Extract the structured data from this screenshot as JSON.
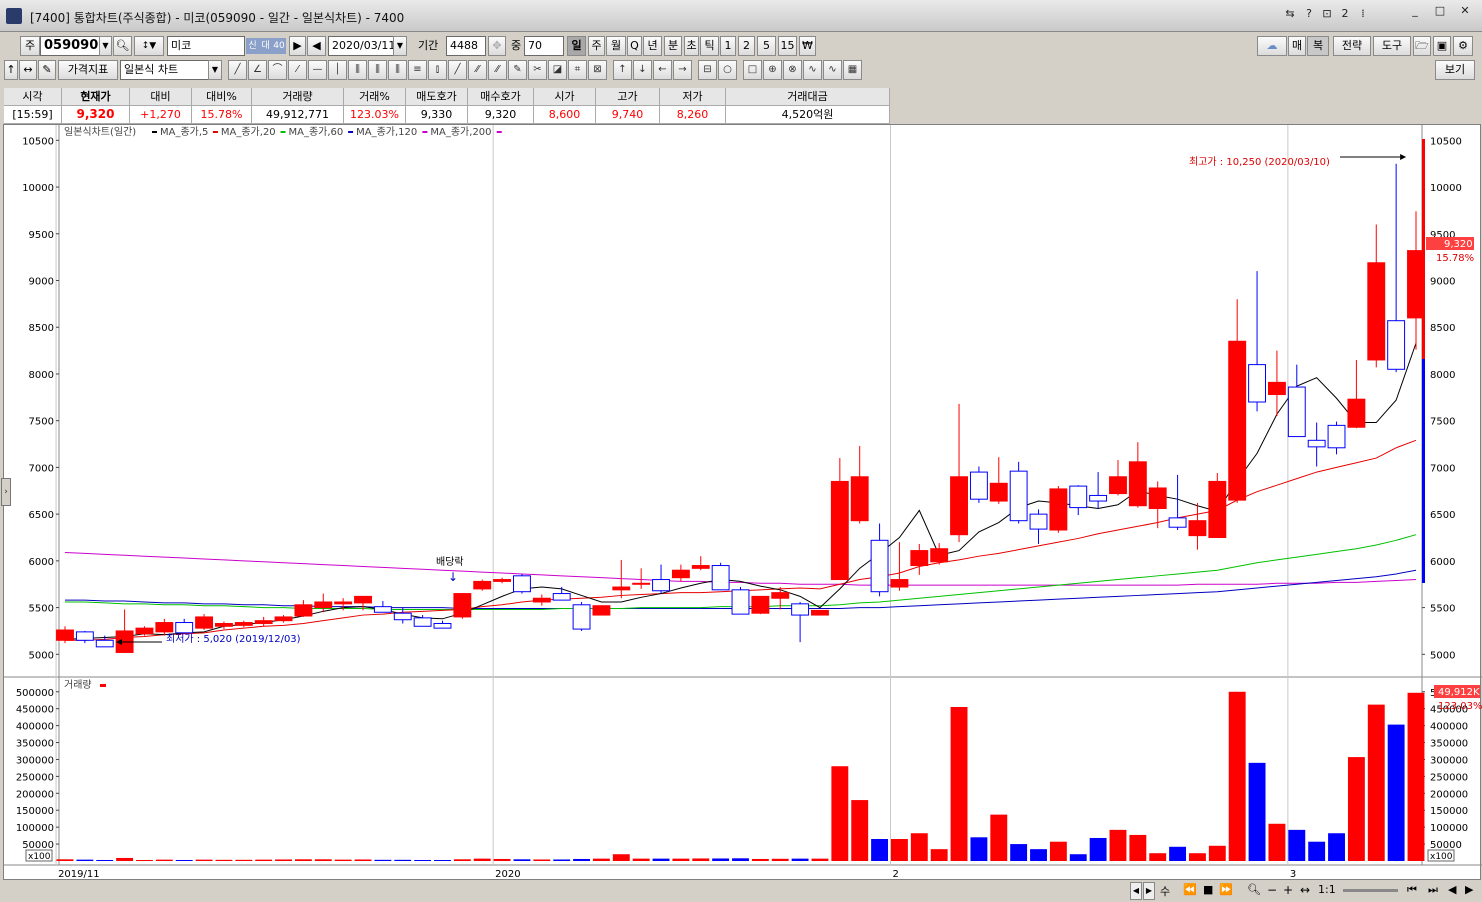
{
  "window": {
    "title": "[7400] 통합차트(주식종합) - 미코(059090 - 일간 - 일본식차트) - 7400",
    "title_icons": [
      "⇆",
      "?",
      "⊡",
      "2",
      "⁞"
    ],
    "controls": [
      "_",
      "□",
      "✕"
    ]
  },
  "toolbar1": {
    "market_label": "주",
    "code": "059090",
    "name": "미코",
    "name_badges": [
      "신",
      "대",
      "40"
    ],
    "date": "2020/03/11",
    "period_label": "기간",
    "period_value": "4488",
    "count_label": "중",
    "count_value": "70",
    "period_buttons": [
      "일",
      "주",
      "월",
      "Q",
      "년",
      "분",
      "초",
      "틱",
      "1",
      "2",
      "5",
      "15",
      "₩"
    ],
    "right_buttons": [
      "매",
      "복",
      "전략",
      "도구"
    ]
  },
  "toolbar2": {
    "indicator_label": "가격지표",
    "chart_type": "일본식 차트",
    "view_label": "보기"
  },
  "quote": {
    "headers": [
      "시각",
      "현재가",
      "대비",
      "대비%",
      "거래량",
      "거래%",
      "매도호가",
      "매수호가",
      "시가",
      "고가",
      "저가",
      "거래대금"
    ],
    "values": [
      "[15:59]",
      "9,320",
      "+1,270",
      "15.78%",
      "49,912,771",
      "123.03%",
      "9,330",
      "9,320",
      "8,600",
      "9,740",
      "8,260",
      "4,520억원"
    ]
  },
  "chart_data": {
    "type": "candlestick",
    "title": "일본식차트(일간)",
    "legend": [
      {
        "name": "MA_종가,5",
        "color": "#000000"
      },
      {
        "name": "MA_종가,20",
        "color": "#e60000"
      },
      {
        "name": "MA_종가,60",
        "color": "#00c000"
      },
      {
        "name": "MA_종가,120",
        "color": "#0000c0"
      },
      {
        "name": "MA_종가,200",
        "color": "#cc00cc"
      }
    ],
    "y_ticks": [
      "10500",
      "10000",
      "9500",
      "9000",
      "8500",
      "8000",
      "7500",
      "7000",
      "6500",
      "6000",
      "5500",
      "5000"
    ],
    "ylim": [
      4800,
      10600
    ],
    "x_labels": [
      {
        "label": "2019/11",
        "index": 0
      },
      {
        "label": "2020",
        "index": 22
      },
      {
        "label": "2",
        "index": 42
      },
      {
        "label": "3",
        "index": 62
      }
    ],
    "annotations": {
      "high": "최고가 : 10,250 (2020/03/10)",
      "low": "최저가 : 5,020 (2019/12/03)",
      "dividend": "배당락"
    },
    "price_tag": "9,320",
    "change_tag": "15.78%",
    "candles": [
      {
        "o": 5150,
        "h": 5300,
        "l": 5120,
        "c": 5260
      },
      {
        "o": 5240,
        "h": 5250,
        "l": 5120,
        "c": 5150
      },
      {
        "o": 5150,
        "h": 5200,
        "l": 5080,
        "c": 5080
      },
      {
        "o": 5020,
        "h": 5480,
        "l": 5020,
        "c": 5250
      },
      {
        "o": 5220,
        "h": 5300,
        "l": 5200,
        "c": 5280
      },
      {
        "o": 5240,
        "h": 5380,
        "l": 5200,
        "c": 5340
      },
      {
        "o": 5340,
        "h": 5380,
        "l": 5220,
        "c": 5230
      },
      {
        "o": 5280,
        "h": 5430,
        "l": 5260,
        "c": 5400
      },
      {
        "o": 5300,
        "h": 5350,
        "l": 5270,
        "c": 5330
      },
      {
        "o": 5310,
        "h": 5360,
        "l": 5290,
        "c": 5340
      },
      {
        "o": 5330,
        "h": 5400,
        "l": 5300,
        "c": 5360
      },
      {
        "o": 5360,
        "h": 5420,
        "l": 5340,
        "c": 5400
      },
      {
        "o": 5410,
        "h": 5580,
        "l": 5400,
        "c": 5530
      },
      {
        "o": 5500,
        "h": 5650,
        "l": 5450,
        "c": 5560
      },
      {
        "o": 5540,
        "h": 5600,
        "l": 5470,
        "c": 5560
      },
      {
        "o": 5550,
        "h": 5620,
        "l": 5470,
        "c": 5620
      },
      {
        "o": 5510,
        "h": 5570,
        "l": 5450,
        "c": 5450
      },
      {
        "o": 5440,
        "h": 5500,
        "l": 5330,
        "c": 5370
      },
      {
        "o": 5390,
        "h": 5420,
        "l": 5300,
        "c": 5300
      },
      {
        "o": 5330,
        "h": 5360,
        "l": 5280,
        "c": 5280
      },
      {
        "o": 5400,
        "h": 5650,
        "l": 5380,
        "c": 5650
      },
      {
        "o": 5700,
        "h": 5800,
        "l": 5680,
        "c": 5780
      },
      {
        "o": 5780,
        "h": 5820,
        "l": 5760,
        "c": 5800
      },
      {
        "o": 5840,
        "h": 5860,
        "l": 5650,
        "c": 5670
      },
      {
        "o": 5560,
        "h": 5640,
        "l": 5520,
        "c": 5600
      },
      {
        "o": 5650,
        "h": 5720,
        "l": 5580,
        "c": 5580
      },
      {
        "o": 5530,
        "h": 5560,
        "l": 5250,
        "c": 5270
      },
      {
        "o": 5420,
        "h": 5520,
        "l": 5420,
        "c": 5520
      },
      {
        "o": 5690,
        "h": 6010,
        "l": 5600,
        "c": 5720
      },
      {
        "o": 5760,
        "h": 5920,
        "l": 5700,
        "c": 5760
      },
      {
        "o": 5800,
        "h": 5960,
        "l": 5650,
        "c": 5680
      },
      {
        "o": 5820,
        "h": 5960,
        "l": 5780,
        "c": 5900
      },
      {
        "o": 5920,
        "h": 6050,
        "l": 5900,
        "c": 5950
      },
      {
        "o": 5950,
        "h": 5980,
        "l": 5700,
        "c": 5690
      },
      {
        "o": 5690,
        "h": 5720,
        "l": 5430,
        "c": 5430
      },
      {
        "o": 5440,
        "h": 5620,
        "l": 5430,
        "c": 5620
      },
      {
        "o": 5600,
        "h": 5720,
        "l": 5480,
        "c": 5660
      },
      {
        "o": 5540,
        "h": 5560,
        "l": 5130,
        "c": 5420
      },
      {
        "o": 5420,
        "h": 5470,
        "l": 5420,
        "c": 5470
      },
      {
        "o": 5800,
        "h": 7100,
        "l": 5800,
        "c": 6850
      },
      {
        "o": 6430,
        "h": 7230,
        "l": 6400,
        "c": 6900
      },
      {
        "o": 6220,
        "h": 6400,
        "l": 5620,
        "c": 5670
      },
      {
        "o": 5720,
        "h": 6200,
        "l": 5680,
        "c": 5800
      },
      {
        "o": 5950,
        "h": 6180,
        "l": 5850,
        "c": 6110
      },
      {
        "o": 5990,
        "h": 6190,
        "l": 5960,
        "c": 6130
      },
      {
        "o": 6280,
        "h": 7680,
        "l": 6200,
        "c": 6900
      },
      {
        "o": 6950,
        "h": 7010,
        "l": 6620,
        "c": 6660
      },
      {
        "o": 6640,
        "h": 7110,
        "l": 6610,
        "c": 6830
      },
      {
        "o": 6960,
        "h": 7060,
        "l": 6400,
        "c": 6430
      },
      {
        "o": 6500,
        "h": 6550,
        "l": 6180,
        "c": 6340
      },
      {
        "o": 6330,
        "h": 6800,
        "l": 6300,
        "c": 6770
      },
      {
        "o": 6800,
        "h": 6810,
        "l": 6490,
        "c": 6570
      },
      {
        "o": 6700,
        "h": 6950,
        "l": 6560,
        "c": 6640
      },
      {
        "o": 6720,
        "h": 7080,
        "l": 6700,
        "c": 6900
      },
      {
        "o": 6590,
        "h": 7270,
        "l": 6570,
        "c": 7060
      },
      {
        "o": 6560,
        "h": 6850,
        "l": 6350,
        "c": 6780
      },
      {
        "o": 6460,
        "h": 6920,
        "l": 6330,
        "c": 6360
      },
      {
        "o": 6270,
        "h": 6620,
        "l": 6120,
        "c": 6430
      },
      {
        "o": 6250,
        "h": 6940,
        "l": 6250,
        "c": 6850
      },
      {
        "o": 6650,
        "h": 8800,
        "l": 6620,
        "c": 8350
      },
      {
        "o": 8100,
        "h": 9100,
        "l": 7600,
        "c": 7700
      },
      {
        "o": 7780,
        "h": 8250,
        "l": 7550,
        "c": 7910
      },
      {
        "o": 7860,
        "h": 8100,
        "l": 7330,
        "c": 7330
      },
      {
        "o": 7290,
        "h": 7480,
        "l": 7010,
        "c": 7220
      },
      {
        "o": 7450,
        "h": 7490,
        "l": 7140,
        "c": 7210
      },
      {
        "o": 7430,
        "h": 8150,
        "l": 7420,
        "c": 7730
      },
      {
        "o": 8150,
        "h": 9600,
        "l": 8070,
        "c": 9190
      },
      {
        "o": 8570,
        "h": 10250,
        "l": 8020,
        "c": 8050
      },
      {
        "o": 8600,
        "h": 9740,
        "l": 8260,
        "c": 9320
      }
    ],
    "ma5": [
      5160,
      5170,
      5180,
      5190,
      5220,
      5210,
      5230,
      5240,
      5300,
      5320,
      5340,
      5370,
      5410,
      5460,
      5500,
      5510,
      5480,
      5430,
      5390,
      5380,
      5440,
      5530,
      5620,
      5700,
      5720,
      5700,
      5630,
      5560,
      5560,
      5610,
      5650,
      5710,
      5760,
      5800,
      5780,
      5730,
      5690,
      5620,
      5500,
      5700,
      5920,
      6080,
      6250,
      6540,
      6060,
      6110,
      6310,
      6410,
      6570,
      6640,
      6620,
      6590,
      6560,
      6600,
      6750,
      6700,
      6660,
      6590,
      6530,
      6860,
      7150,
      7570,
      7870,
      7960,
      7740,
      7480,
      7480,
      7720,
      8330
    ],
    "ma20": [
      5150,
      5150,
      5160,
      5180,
      5190,
      5210,
      5220,
      5230,
      5260,
      5280,
      5300,
      5310,
      5330,
      5360,
      5390,
      5420,
      5430,
      5450,
      5460,
      5470,
      5480,
      5510,
      5530,
      5560,
      5580,
      5590,
      5600,
      5610,
      5630,
      5640,
      5650,
      5660,
      5660,
      5670,
      5680,
      5690,
      5700,
      5710,
      5700,
      5750,
      5800,
      5830,
      5870,
      5940,
      5980,
      6010,
      6050,
      6080,
      6120,
      6160,
      6200,
      6240,
      6290,
      6330,
      6370,
      6410,
      6460,
      6500,
      6540,
      6650,
      6740,
      6810,
      6880,
      6950,
      7000,
      7050,
      7100,
      7210,
      7290
    ],
    "ma60": [
      5560,
      5560,
      5550,
      5540,
      5540,
      5530,
      5530,
      5520,
      5520,
      5510,
      5500,
      5500,
      5490,
      5490,
      5490,
      5490,
      5480,
      5480,
      5480,
      5480,
      5480,
      5480,
      5480,
      5480,
      5480,
      5490,
      5490,
      5490,
      5490,
      5500,
      5500,
      5500,
      5500,
      5510,
      5510,
      5510,
      5520,
      5520,
      5520,
      5530,
      5550,
      5560,
      5580,
      5600,
      5620,
      5640,
      5660,
      5680,
      5700,
      5720,
      5740,
      5760,
      5780,
      5800,
      5820,
      5840,
      5860,
      5880,
      5900,
      5940,
      5980,
      6010,
      6040,
      6070,
      6100,
      6130,
      6170,
      6220,
      6280
    ],
    "ma120": [
      5580,
      5580,
      5570,
      5570,
      5560,
      5550,
      5550,
      5540,
      5540,
      5530,
      5530,
      5520,
      5520,
      5510,
      5510,
      5510,
      5500,
      5500,
      5500,
      5500,
      5490,
      5490,
      5490,
      5490,
      5490,
      5490,
      5490,
      5490,
      5490,
      5490,
      5490,
      5490,
      5490,
      5490,
      5490,
      5490,
      5490,
      5490,
      5490,
      5490,
      5500,
      5500,
      5510,
      5520,
      5530,
      5540,
      5550,
      5560,
      5570,
      5580,
      5590,
      5600,
      5610,
      5620,
      5630,
      5640,
      5650,
      5660,
      5670,
      5690,
      5710,
      5730,
      5750,
      5770,
      5790,
      5810,
      5830,
      5860,
      5900
    ],
    "ma200": [
      6090,
      6080,
      6070,
      6060,
      6050,
      6040,
      6030,
      6020,
      6010,
      6000,
      5990,
      5980,
      5970,
      5960,
      5950,
      5940,
      5930,
      5920,
      5910,
      5900,
      5890,
      5880,
      5870,
      5860,
      5850,
      5840,
      5830,
      5820,
      5810,
      5800,
      5790,
      5780,
      5780,
      5770,
      5770,
      5760,
      5760,
      5750,
      5750,
      5750,
      5740,
      5740,
      5740,
      5740,
      5740,
      5740,
      5740,
      5740,
      5740,
      5740,
      5740,
      5740,
      5740,
      5740,
      5740,
      5740,
      5740,
      5750,
      5750,
      5750,
      5750,
      5760,
      5760,
      5760,
      5770,
      5770,
      5780,
      5790,
      5800
    ],
    "volume": {
      "title": "거래량",
      "y_ticks": [
        "500000",
        "450000",
        "400000",
        "350000",
        "300000",
        "250000",
        "200000",
        "150000",
        "100000",
        "50000"
      ],
      "ylim": [
        0,
        520000
      ],
      "values": [
        5000,
        4000,
        3000,
        9000,
        3000,
        4000,
        3000,
        4000,
        3500,
        3500,
        4000,
        4500,
        5000,
        5000,
        4000,
        4500,
        3500,
        3500,
        3000,
        3000,
        5000,
        7000,
        6000,
        5000,
        4500,
        4500,
        6000,
        7000,
        20000,
        7000,
        7000,
        7000,
        7500,
        7500,
        8000,
        6000,
        6500,
        7000,
        7000,
        280000,
        180000,
        65000,
        65000,
        82000,
        35000,
        455000,
        70000,
        137000,
        50000,
        35000,
        57000,
        20000,
        68000,
        92000,
        77000,
        23000,
        42000,
        23000,
        45000,
        500000,
        290000,
        110000,
        92000,
        57000,
        82000,
        307000,
        462000,
        403000,
        497000
      ],
      "value_tag": "49,912K",
      "pct_tag": "123.03%",
      "unit_tag": "x100"
    }
  },
  "colors": {
    "up": "#ff0000",
    "down": "#0000ff",
    "grid": "#c8c8c8"
  }
}
